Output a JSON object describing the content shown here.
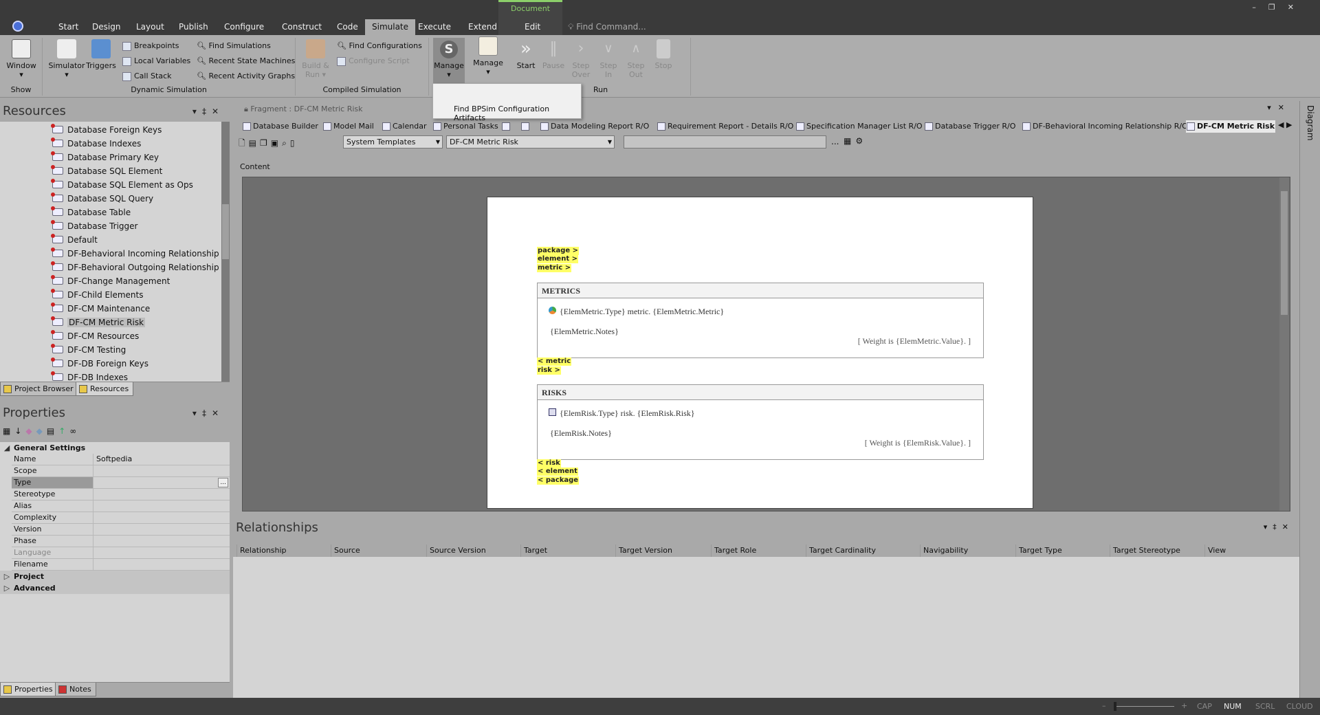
{
  "menu": {
    "tabs": [
      "Start",
      "Design",
      "Layout",
      "Publish",
      "Configure",
      "Construct",
      "Code",
      "Simulate",
      "Execute",
      "Extend"
    ],
    "active": "Simulate",
    "context_group": "Document",
    "context_tab": "Edit",
    "find_command": "Find Command..."
  },
  "ribbon": {
    "show": {
      "label": "Show",
      "window": "Window"
    },
    "dynamic": {
      "label": "Dynamic Simulation",
      "simulator": "Simulator",
      "triggers": "Triggers",
      "breakpoints": "Breakpoints",
      "local_variables": "Local Variables",
      "call_stack": "Call Stack",
      "find_simulations": "Find Simulations",
      "recent_state_machines": "Recent State Machines",
      "recent_activity_graphs": "Recent Activity Graphs"
    },
    "compiled": {
      "label": "Compiled Simulation",
      "build_run": "Build & Run",
      "find_configurations": "Find Configurations",
      "configure_script": "Configure Script"
    },
    "manage1": "Manage",
    "manage2": "Manage",
    "run": {
      "label": "Run",
      "start": "Start",
      "pause": "Pause",
      "step_over": "Step Over",
      "step_in": "Step In",
      "step_out": "Step Out",
      "stop": "Stop"
    }
  },
  "popup": {
    "item": "Find BPSim Configuration Artifacts"
  },
  "resources": {
    "title": "Resources",
    "items": [
      "Database Foreign Keys",
      "Database Indexes",
      "Database Primary Key",
      "Database SQL Element",
      "Database SQL Element as Ops",
      "Database SQL Query",
      "Database Table",
      "Database Trigger",
      "Default",
      "DF-Behavioral Incoming Relationship",
      "DF-Behavioral Outgoing Relationship",
      "DF-Change Management",
      "DF-Child Elements",
      "DF-CM Maintenance",
      "DF-CM Metric Risk",
      "DF-CM Resources",
      "DF-CM Testing",
      "DF-DB Foreign Keys",
      "DF-DB Indexes"
    ],
    "selected": "DF-CM Metric Risk",
    "tabs": [
      "Project Browser",
      "Resources"
    ]
  },
  "properties": {
    "title": "Properties",
    "group": "General Settings",
    "rows": [
      {
        "k": "Name",
        "v": "Softpedia"
      },
      {
        "k": "Scope",
        "v": ""
      },
      {
        "k": "Type",
        "v": ""
      },
      {
        "k": "Stereotype",
        "v": ""
      },
      {
        "k": "Alias",
        "v": ""
      },
      {
        "k": "Complexity",
        "v": ""
      },
      {
        "k": "Version",
        "v": ""
      },
      {
        "k": "Phase",
        "v": ""
      },
      {
        "k": "Language",
        "v": ""
      },
      {
        "k": "Filename",
        "v": ""
      }
    ],
    "groups_collapsed": [
      "Project",
      "Advanced"
    ],
    "tabs": [
      "Properties",
      "Notes"
    ],
    "ellipsis": "..."
  },
  "editor": {
    "fragment_title": "Fragment : DF-CM Metric Risk",
    "tabs": [
      "Database Builder",
      "Model Mail",
      "Calendar",
      "Personal Tasks",
      "",
      "",
      "Data Modeling Report R/O",
      "Requirement Report - Details R/O",
      "Specification Manager List R/O",
      "Database Trigger R/O",
      "DF-Behavioral Incoming Relationship R/O",
      "DF-CM Metric Risk R/O"
    ],
    "template_select": "System Templates",
    "fragment_select": "DF-CM Metric Risk",
    "search_value": "",
    "ellipsis": "...",
    "content_label": "Content",
    "side_tab": "Diagram"
  },
  "doc": {
    "tags_top": [
      "package >",
      "element >",
      "metric >"
    ],
    "metrics": {
      "heading": "METRICS",
      "line1": "{ElemMetric.Type} metric.  {ElemMetric.Metric}",
      "notes": "{ElemMetric.Notes}",
      "weight": "[ Weight is {ElemMetric.Value}. ]"
    },
    "tags_mid": [
      "< metric",
      "risk >"
    ],
    "risks": {
      "heading": "RISKS",
      "line1": "{ElemRisk.Type} risk.  {ElemRisk.Risk}",
      "notes": "{ElemRisk.Notes}",
      "weight": "[ Weight is {ElemRisk.Value}. ]"
    },
    "tags_bottom": [
      "< risk",
      "< element",
      "< package"
    ]
  },
  "relationships": {
    "title": "Relationships",
    "columns": [
      "Relationship",
      "Source",
      "Source Version",
      "Target",
      "Target Version",
      "Target Role",
      "Target Cardinality",
      "Navigability",
      "Target Type",
      "Target Stereotype",
      "View"
    ]
  },
  "status": {
    "zoom_minus": "–",
    "zoom_plus": "+",
    "cap": "CAP",
    "num": "NUM",
    "scrl": "SCRL",
    "cloud": "CLOUD"
  }
}
